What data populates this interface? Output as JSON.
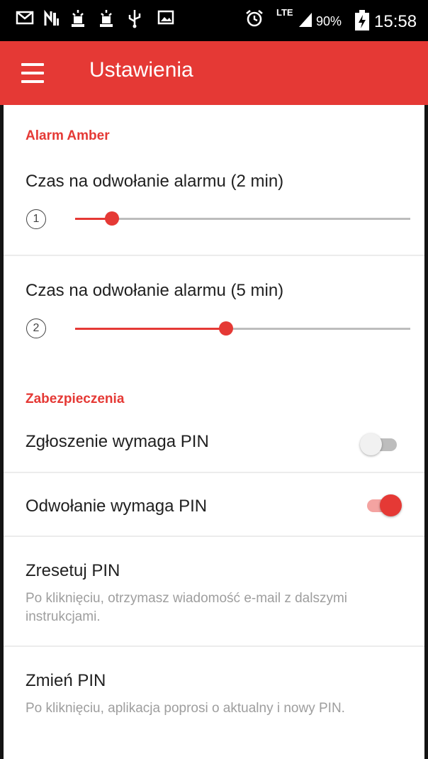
{
  "status_bar": {
    "icons": [
      "mail-icon",
      "nfc-icon",
      "notification-icon",
      "notification-icon",
      "usb-icon",
      "image-icon",
      "alarm-icon",
      "lte-icon",
      "signal-icon",
      "battery-charging-icon"
    ],
    "network": "LTE",
    "battery": "90%",
    "time": "15:58"
  },
  "toolbar": {
    "title": "Ustawienia",
    "color": "#e53935"
  },
  "sections": {
    "alarm": {
      "header": "Alarm Amber",
      "slider1": {
        "title": "Czas na odwołanie alarmu (2 min)",
        "badge": "1",
        "value_fraction": 0.11
      },
      "slider2": {
        "title": "Czas na odwołanie alarmu (5 min)",
        "badge": "2",
        "value_fraction": 0.45
      }
    },
    "security": {
      "header": "Zabezpieczenia",
      "require_pin_report": {
        "title": "Zgłoszenie wymaga PIN",
        "enabled": false
      },
      "require_pin_cancel": {
        "title": "Odwołanie wymaga PIN",
        "enabled": true
      },
      "reset_pin": {
        "title": "Zresetuj PIN",
        "summary": "Po kliknięciu, otrzymasz wiadomość e-mail z dalszymi instrukcjami."
      },
      "change_pin": {
        "title": "Zmień PIN",
        "summary": "Po kliknięciu, aplikacja poprosi o aktualny i nowy PIN."
      }
    }
  }
}
